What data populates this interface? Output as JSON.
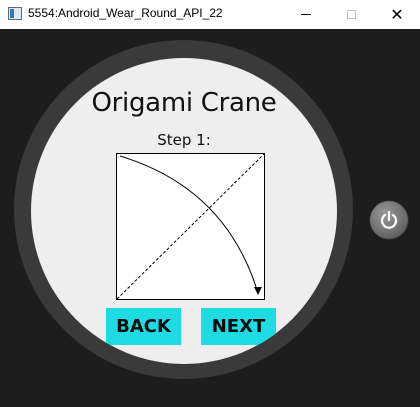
{
  "window": {
    "title": "5554:Android_Wear_Round_API_22",
    "minimize_icon": "minimize-icon",
    "maximize_icon": "maximize-icon",
    "close_icon": "close-icon"
  },
  "watch": {
    "app_title": "Origami Crane",
    "step_label": "Step 1:",
    "diagram_icon": "fold-diagram",
    "back_label": "BACK",
    "next_label": "NEXT",
    "button_color": "#1ddbe3",
    "screen_color": "#eeeeee",
    "bezel_color": "#3a3a3a"
  },
  "emulator": {
    "power_icon": "power-icon"
  }
}
